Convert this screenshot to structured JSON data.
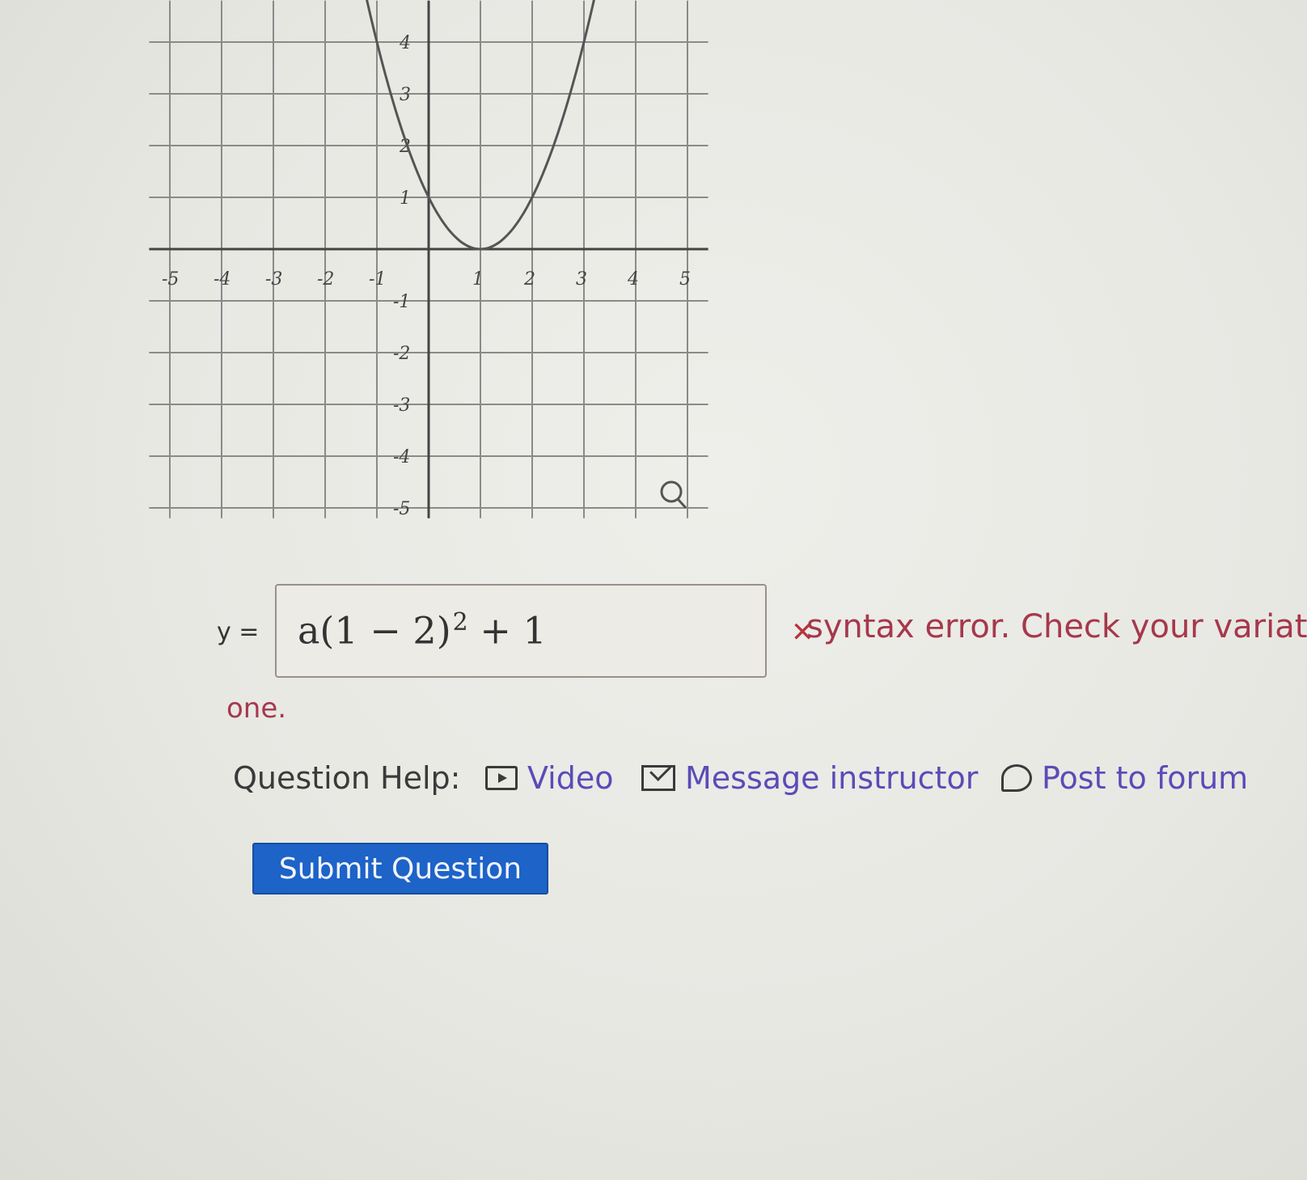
{
  "graph": {
    "x_ticks": [
      "-5",
      "-4",
      "-3",
      "-2",
      "-1",
      "1",
      "2",
      "3",
      "4",
      "5"
    ],
    "y_ticks_pos": [
      "4",
      "3",
      "2",
      "1"
    ],
    "y_ticks_neg": [
      "-1",
      "-2",
      "-3",
      "-4",
      "-5"
    ],
    "curve": {
      "vertex": [
        1,
        0
      ],
      "a": 1
    },
    "curve_color": "#555555",
    "zoom_icon": "magnifier-icon"
  },
  "answer": {
    "y_label": "y =",
    "expr_base": "a(1 − 2)",
    "expr_exp": "2",
    "expr_tail": " + 1",
    "status_icon": "wrong-x-icon",
    "feedback": "syntax error. Check your variat",
    "feedback_cont": "one."
  },
  "help": {
    "label": "Question Help:",
    "video": "Video",
    "message": "Message instructor",
    "forum": "Post to forum"
  },
  "submit": {
    "label": "Submit Question"
  },
  "colors": {
    "link": "#5a4bb8",
    "error": "#a6384b",
    "button": "#1d63c8"
  }
}
